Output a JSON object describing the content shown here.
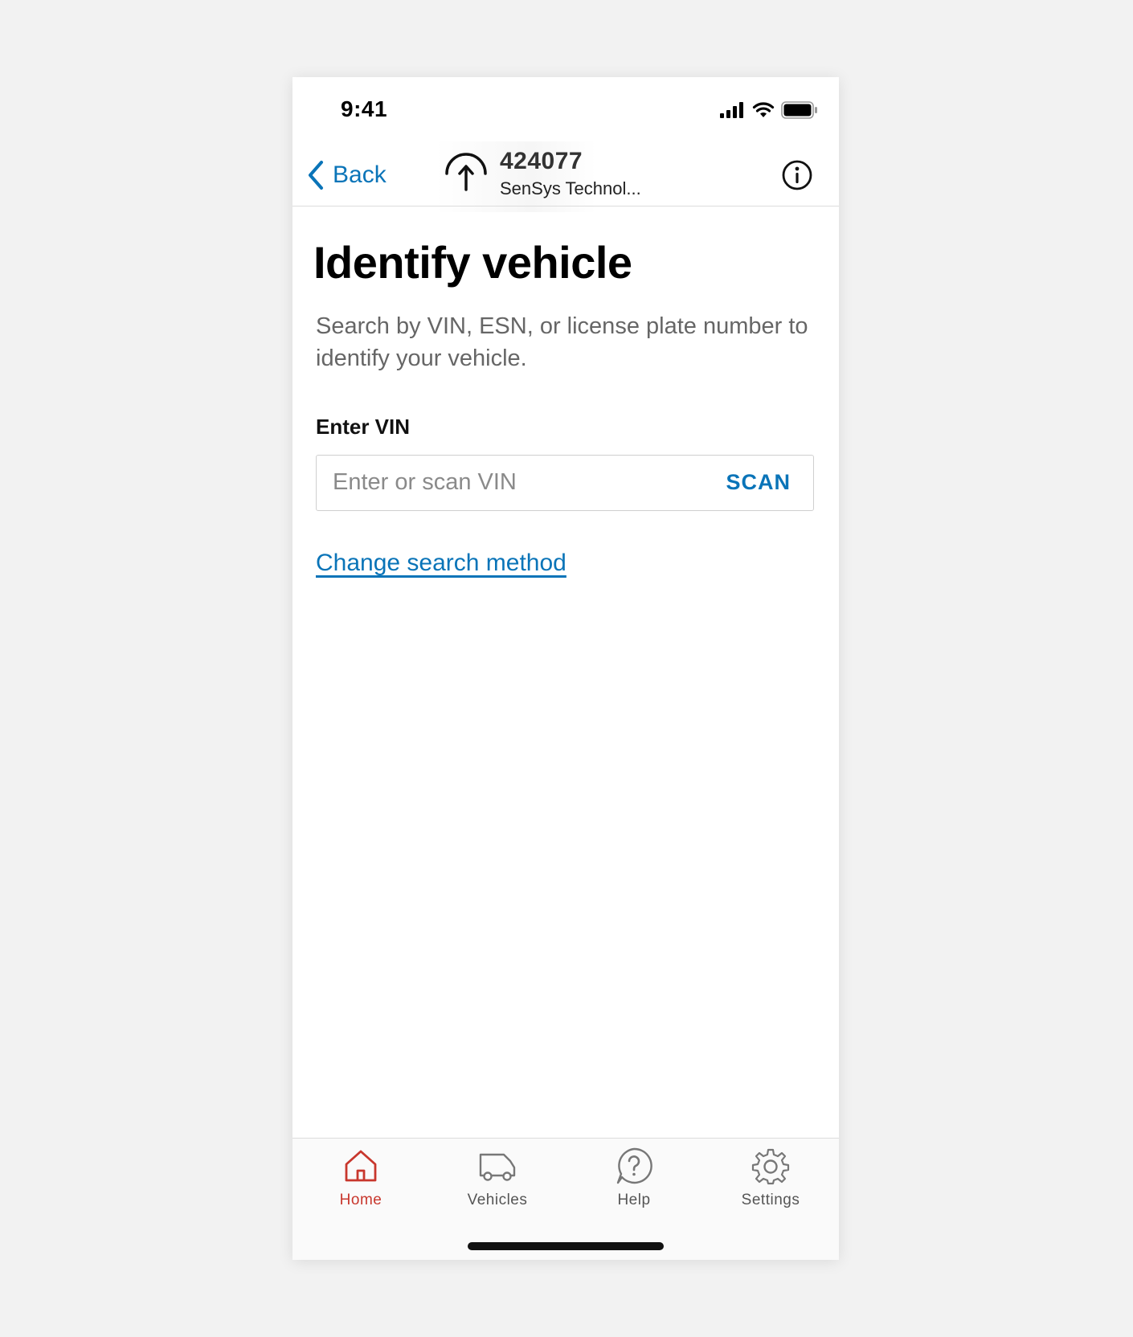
{
  "status_bar": {
    "time": "9:41",
    "icons": [
      "cellular-signal-icon",
      "wifi-icon",
      "battery-icon"
    ]
  },
  "nav": {
    "back_label": "Back",
    "device_id": "424077",
    "device_name": "SenSys Technol...",
    "device_icon": "upload-arc-icon",
    "info_icon": "info-icon"
  },
  "main": {
    "title": "Identify vehicle",
    "description": "Search by VIN, ESN, or license plate number to identify your vehicle.",
    "vin_label": "Enter VIN",
    "vin_value": "",
    "vin_placeholder": "Enter or scan VIN",
    "scan_label": "SCAN",
    "change_method_label": "Change search method"
  },
  "tab_bar": {
    "tabs": [
      {
        "label": "Home",
        "icon": "home-icon",
        "active": true
      },
      {
        "label": "Vehicles",
        "icon": "truck-icon",
        "active": false
      },
      {
        "label": "Help",
        "icon": "help-icon",
        "active": false
      },
      {
        "label": "Settings",
        "icon": "gear-icon",
        "active": false
      }
    ]
  },
  "colors": {
    "accent": "#0a74b8",
    "active_tab": "#c8372d",
    "inactive_tab": "#555555",
    "background": "#f2f2f2"
  }
}
